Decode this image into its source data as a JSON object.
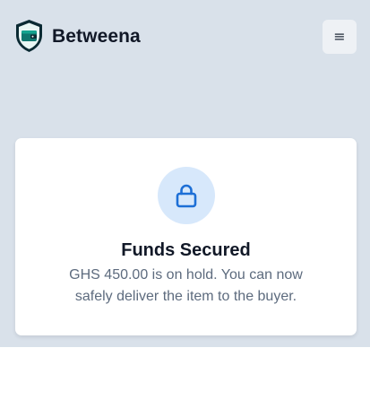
{
  "header": {
    "brand_name": "Betweena",
    "logo_icon": "wallet-shield-icon",
    "menu_icon": "hamburger-menu-icon",
    "menu_glyph": "≡"
  },
  "status_card": {
    "icon": "lock-icon",
    "title": "Funds Secured",
    "message_line1": "GHS 450.00 is on hold. You can now",
    "message_line2": "safely deliver the item to the buyer."
  },
  "colors": {
    "app_background": "#d9e1ea",
    "brand_teal": "#0f766e",
    "accent_blue": "#1d6fd6",
    "icon_circle": "#d7e8fb",
    "title_text": "#111827",
    "body_text": "#5d6b7e"
  }
}
